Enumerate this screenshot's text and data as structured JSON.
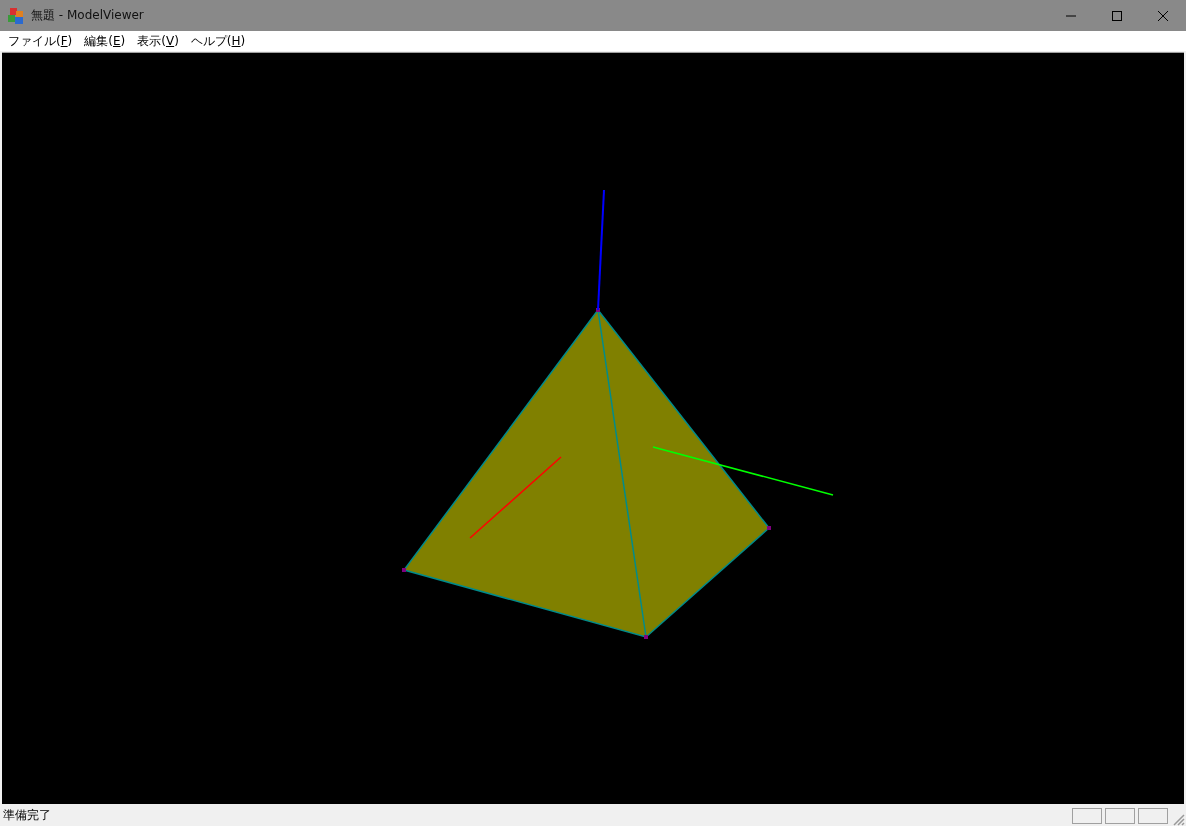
{
  "window": {
    "title": "無題 - ModelViewer"
  },
  "menu": [
    {
      "label": "ファイル(F)"
    },
    {
      "label": "編集(E)"
    },
    {
      "label": "表示(V)"
    },
    {
      "label": "ヘルプ(H)"
    }
  ],
  "status_bar": {
    "text": "準備完了"
  }
}
